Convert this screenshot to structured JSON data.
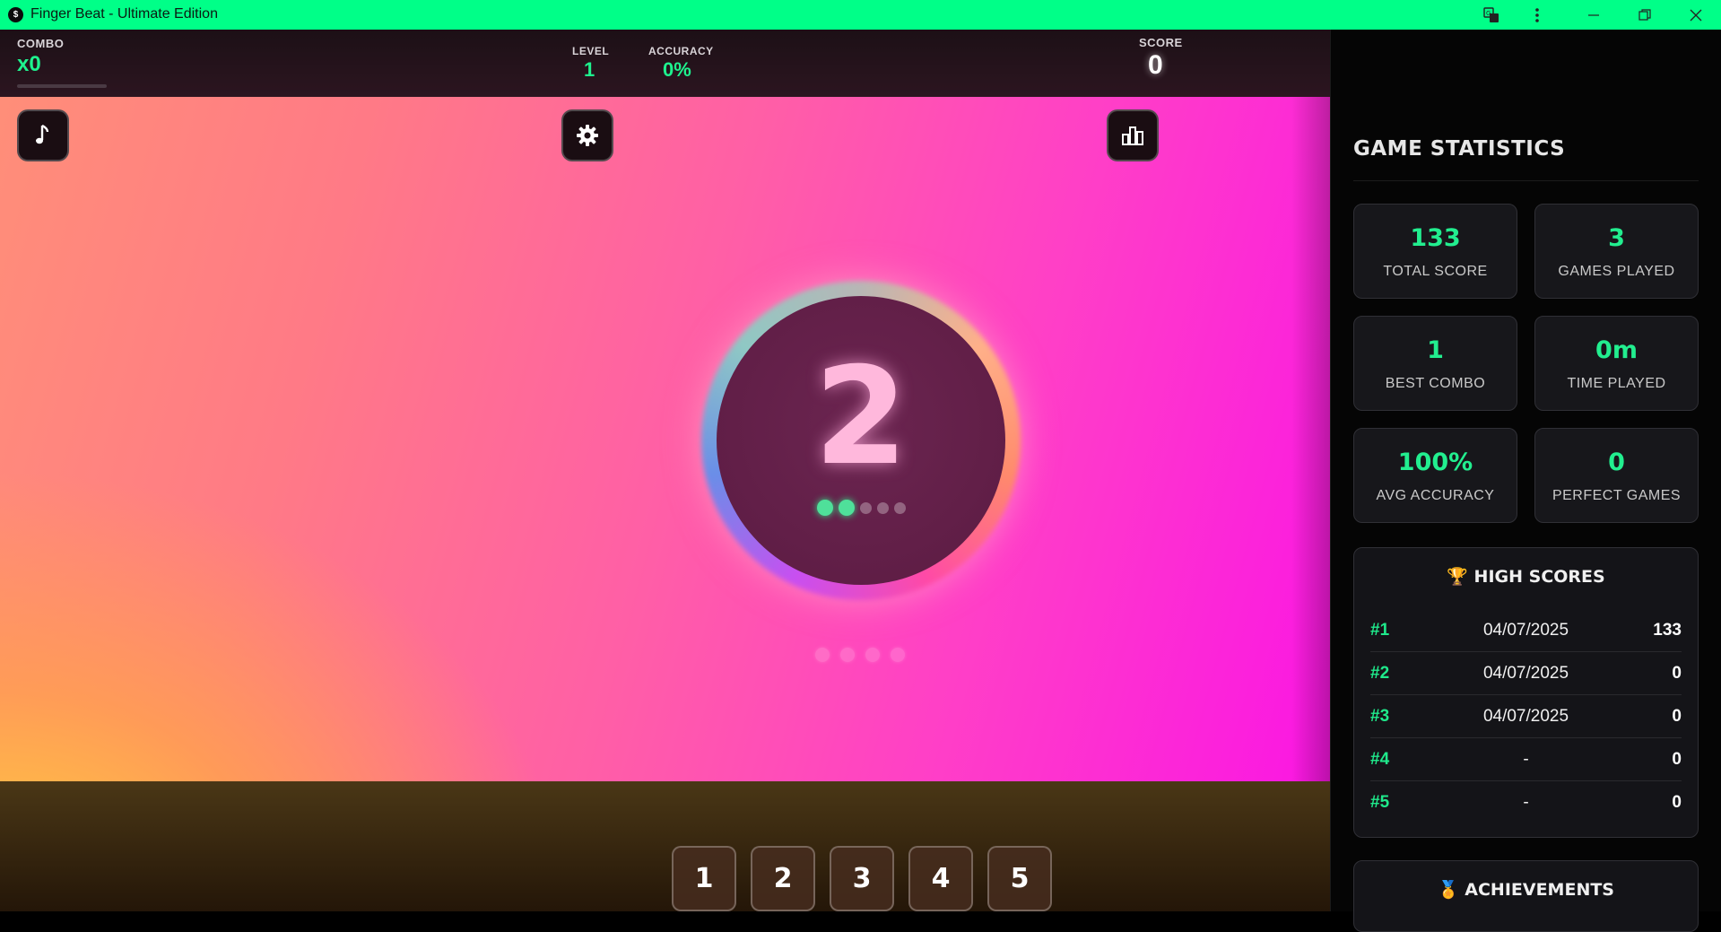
{
  "window": {
    "title": "Finger Beat - Ultimate Edition",
    "icon": "finger-beat-logo",
    "controls": [
      "translate-icon",
      "more-vertical-icon",
      "minimize-icon",
      "maximize-icon",
      "close-icon"
    ]
  },
  "hud": {
    "combo_label": "COMBO",
    "combo_value": "x0",
    "level_label": "LEVEL",
    "level_value": "1",
    "accuracy_label": "ACCURACY",
    "accuracy_value": "0%",
    "score_label": "SCORE",
    "score_value": "0"
  },
  "toolbar": {
    "music": "music-note-icon",
    "settings": "gear-icon",
    "stats": "bar-chart-icon"
  },
  "target": {
    "number": "2",
    "progress_filled": 2,
    "progress_total": 5,
    "outer_dots": 4
  },
  "keys": [
    "1",
    "2",
    "3",
    "4",
    "5"
  ],
  "sidebar": {
    "title": "GAME STATISTICS",
    "stats": [
      {
        "value": "133",
        "label": "TOTAL SCORE"
      },
      {
        "value": "3",
        "label": "GAMES PLAYED"
      },
      {
        "value": "1",
        "label": "BEST COMBO"
      },
      {
        "value": "0m",
        "label": "TIME PLAYED"
      },
      {
        "value": "100%",
        "label": "AVG ACCURACY"
      },
      {
        "value": "0",
        "label": "PERFECT GAMES"
      }
    ],
    "high_scores": {
      "title": "🏆 HIGH SCORES",
      "rows": [
        {
          "rank": "#1",
          "date": "04/07/2025",
          "score": "133"
        },
        {
          "rank": "#2",
          "date": "04/07/2025",
          "score": "0"
        },
        {
          "rank": "#3",
          "date": "04/07/2025",
          "score": "0"
        },
        {
          "rank": "#4",
          "date": "-",
          "score": "0"
        },
        {
          "rank": "#5",
          "date": "-",
          "score": "0"
        }
      ]
    },
    "achievements": {
      "title": "🏅 ACHIEVEMENTS"
    }
  },
  "colors": {
    "accent": "#00ff88",
    "stat_value": "#22ee8f",
    "target_digit": "#ffb8dc"
  }
}
